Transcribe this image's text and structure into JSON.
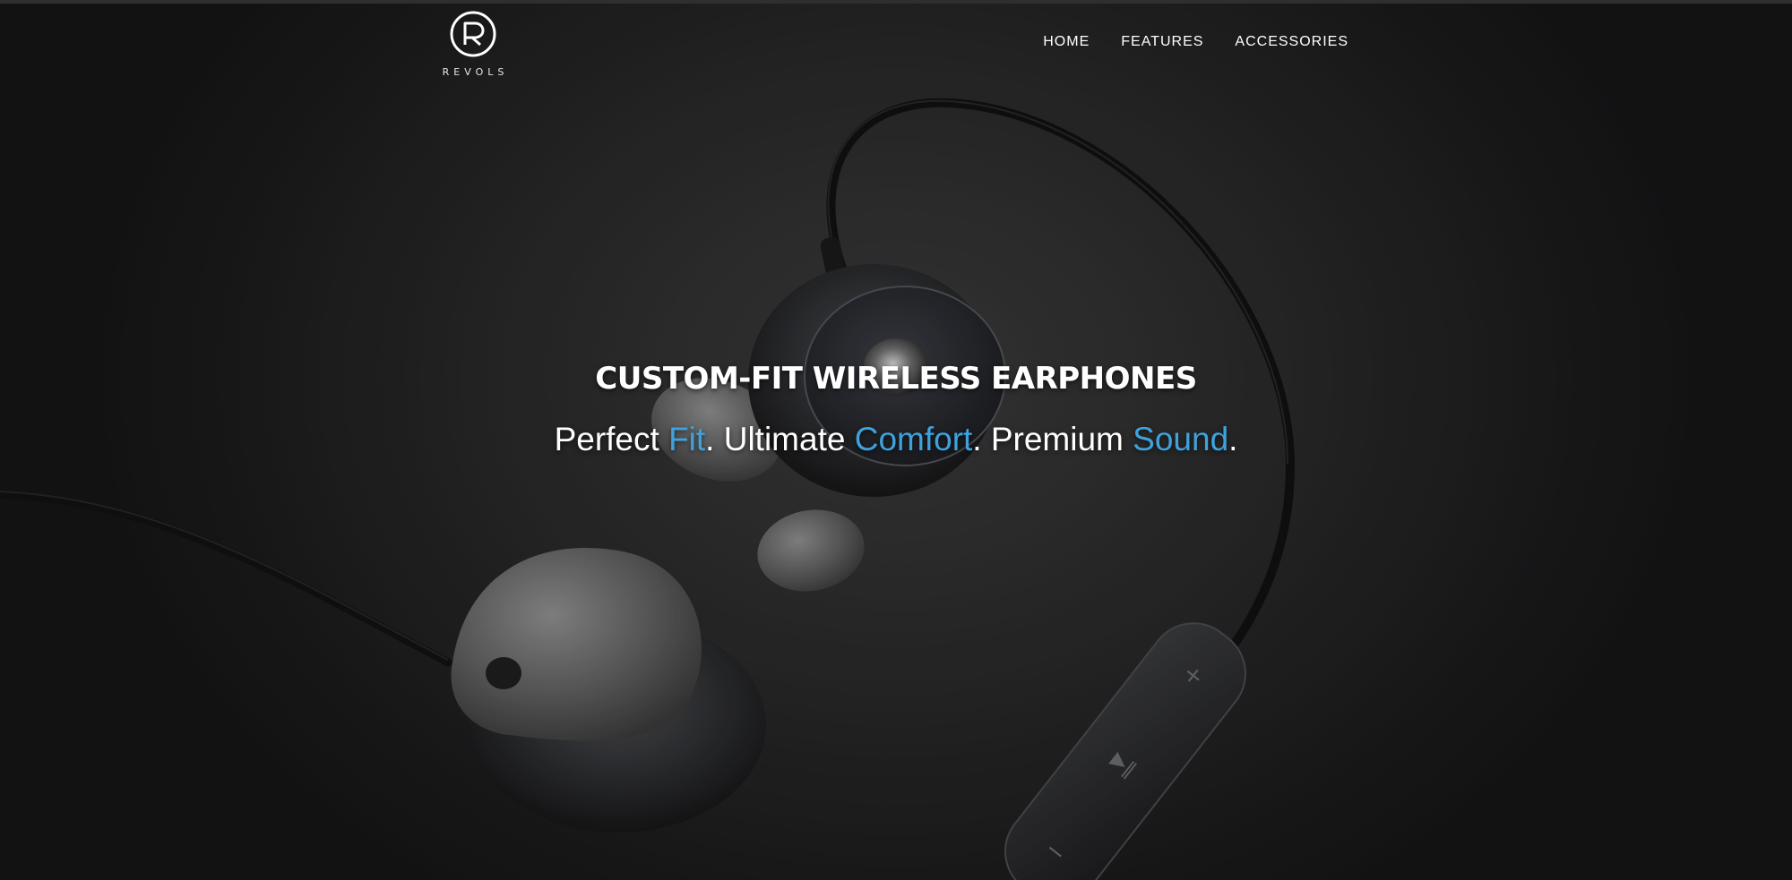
{
  "brand": {
    "name": "REVOLS",
    "logo_icon": "revols-r-circle-logo"
  },
  "nav": {
    "items": [
      {
        "label": "HOME"
      },
      {
        "label": "FEATURES"
      },
      {
        "label": "ACCESSORIES"
      }
    ]
  },
  "hero": {
    "headline": "CUSTOM-FIT WIRELESS EARPHONES",
    "tagline": {
      "part1": "Perfect ",
      "accent1": "Fit",
      "part2": ". Ultimate ",
      "accent2": "Comfort",
      "part3": ". Premium ",
      "accent3": "Sound",
      "part4": "."
    },
    "background_image": "wireless-earphones-photo"
  },
  "colors": {
    "accent": "#3fa2dc",
    "background": "#2a2a2b",
    "text": "#ffffff"
  }
}
